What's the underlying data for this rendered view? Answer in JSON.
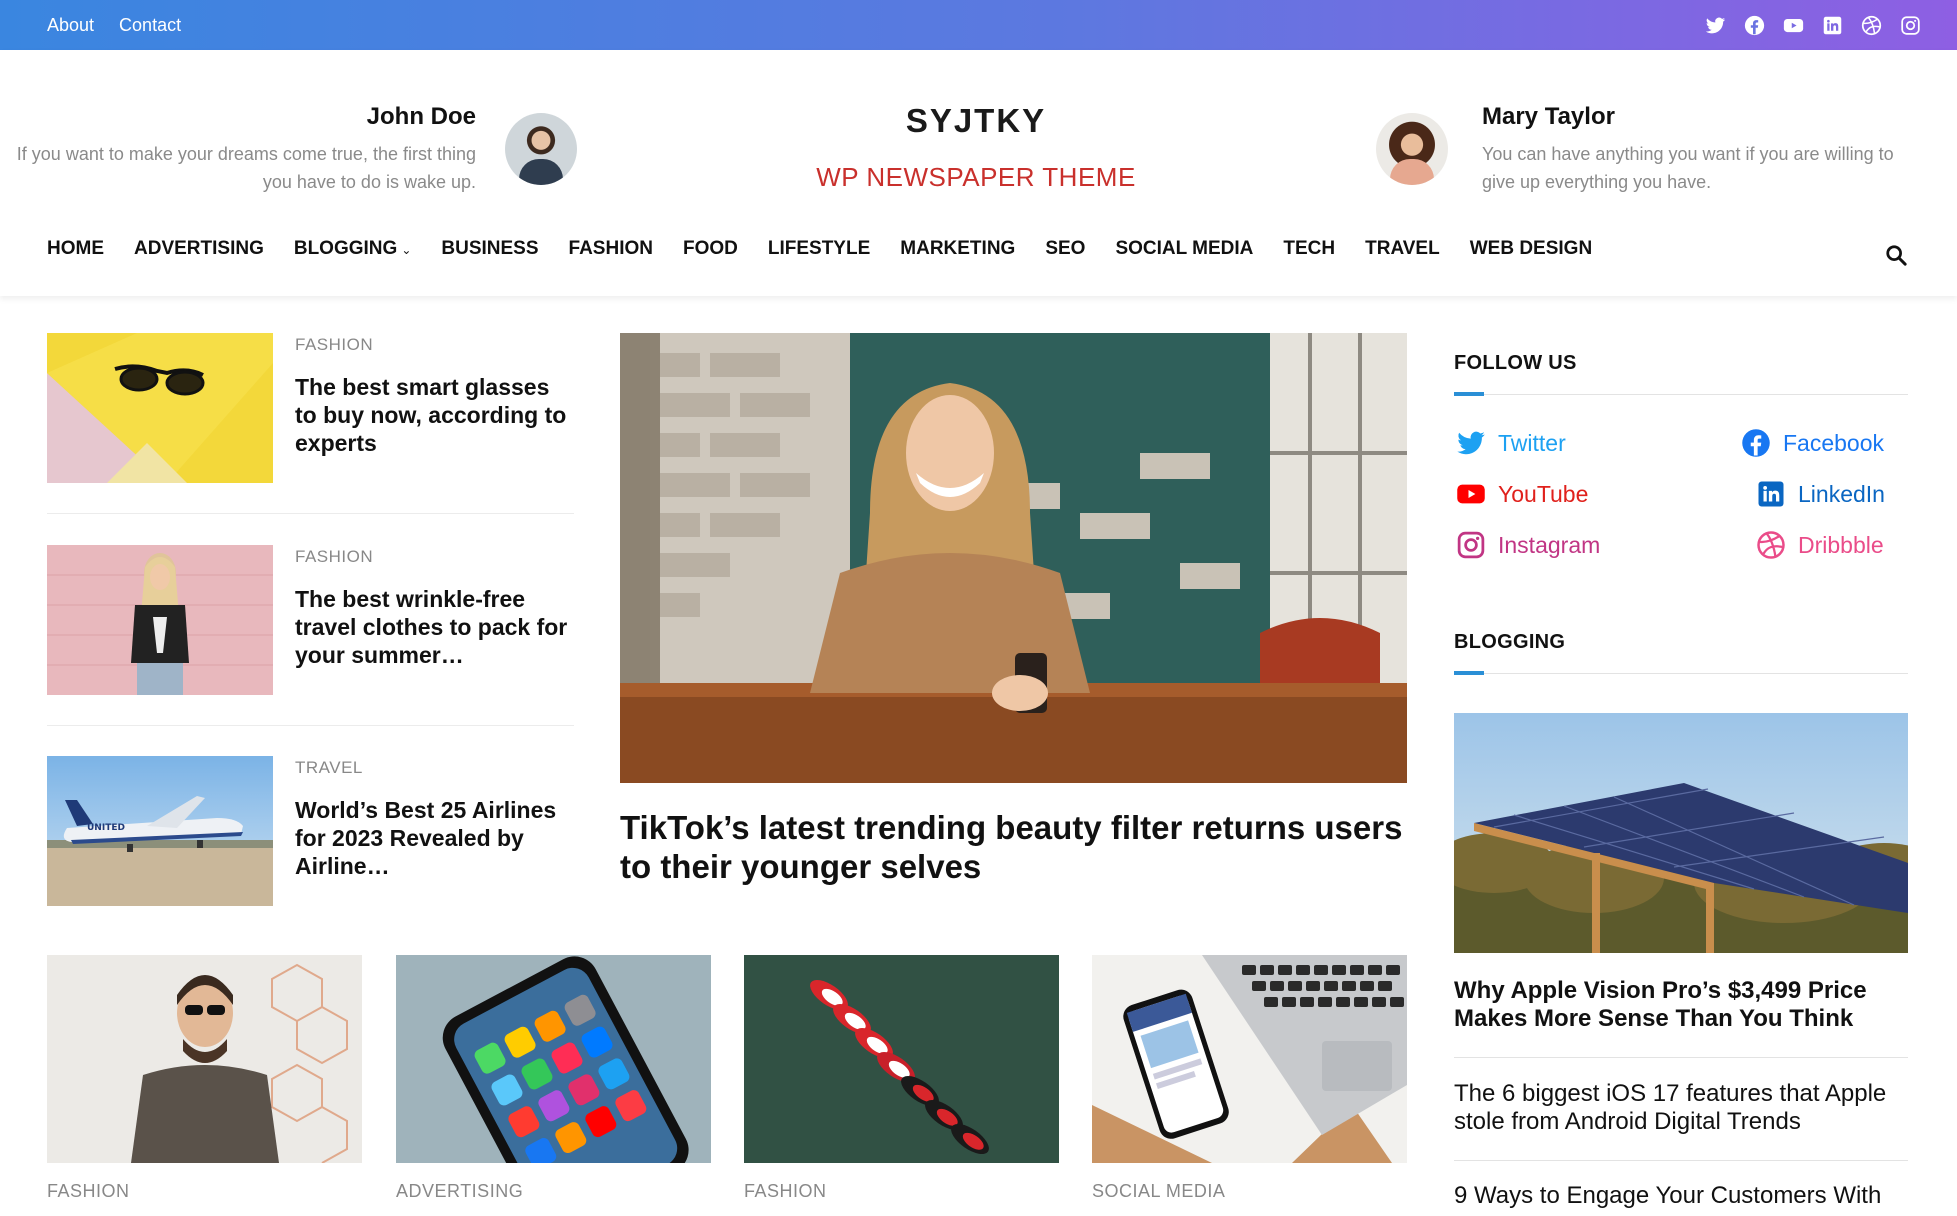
{
  "topbar": {
    "links": [
      "About",
      "Contact"
    ],
    "social_icons": [
      "twitter-icon",
      "facebook-icon",
      "youtube-icon",
      "linkedin-icon",
      "dribbble-icon",
      "instagram-icon"
    ],
    "gradient_start": "#3a86e0",
    "gradient_end": "#8e5fe3"
  },
  "header": {
    "site_title": "SYJTKY",
    "tagline": "WP NEWSPAPER THEME",
    "tagline_color": "#c9302c",
    "author_left": {
      "name": "John Doe",
      "quote": "If you want to make your dreams come true, the first thing you have to do is wake up."
    },
    "author_right": {
      "name": "Mary Taylor",
      "quote": "You can have anything you want if you are willing to give up everything you have."
    }
  },
  "nav": {
    "items": [
      "HOME",
      "ADVERTISING",
      "BLOGGING",
      "BUSINESS",
      "FASHION",
      "FOOD",
      "LIFESTYLE",
      "MARKETING",
      "SEO",
      "SOCIAL MEDIA",
      "TECH",
      "TRAVEL",
      "WEB DESIGN"
    ],
    "dropdown_item": "BLOGGING"
  },
  "left_list": [
    {
      "category": "FASHION",
      "title": "The best smart glasses to buy now, according to experts"
    },
    {
      "category": "FASHION",
      "title": "The best wrinkle-free travel clothes to pack for your summer…"
    },
    {
      "category": "TRAVEL",
      "title": "World’s Best 25 Airlines for 2023 Revealed by Airline…"
    }
  ],
  "hero": {
    "title": "TikTok’s latest trending beauty filter returns users to their younger selves"
  },
  "cards": [
    {
      "category": "FASHION"
    },
    {
      "category": "ADVERTISING"
    },
    {
      "category": "FASHION"
    },
    {
      "category": "SOCIAL MEDIA"
    }
  ],
  "sidebar": {
    "follow_title": "FOLLOW US",
    "follow": [
      {
        "label": "Twitter",
        "icon": "twitter-icon",
        "color": "#1da1f2"
      },
      {
        "label": "Facebook",
        "icon": "facebook-icon",
        "color": "#1877f2"
      },
      {
        "label": "YouTube",
        "icon": "youtube-icon",
        "color": "#ff0000"
      },
      {
        "label": "LinkedIn",
        "icon": "linkedin-icon",
        "color": "#0a66c2"
      },
      {
        "label": "Instagram",
        "icon": "instagram-icon",
        "color": "#c13584"
      },
      {
        "label": "Dribbble",
        "icon": "dribbble-icon",
        "color": "#ea4c89"
      }
    ],
    "blogging_title": "BLOGGING",
    "blogging_feature_title": "Why Apple Vision Pro’s $3,499 Price Makes More Sense Than You Think",
    "blogging_links": [
      "The 6 biggest iOS 17 features that Apple stole from Android Digital Trends",
      "9 Ways to Engage Your Customers With"
    ],
    "accent_color": "#2a8fd6"
  }
}
